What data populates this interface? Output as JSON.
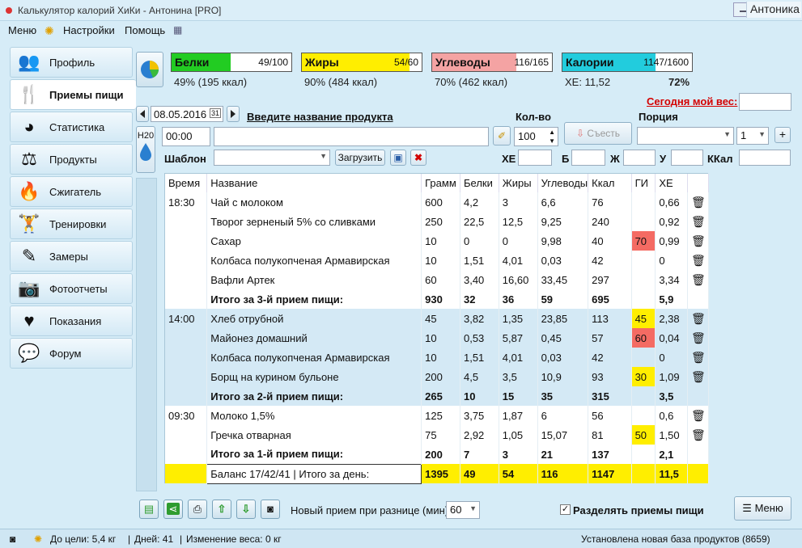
{
  "window": {
    "title": "Калькулятор калорий ХиКи - Антонина [PRO]",
    "user": "Антоника"
  },
  "menu": {
    "m1": "Меню",
    "m2": "Настройки",
    "m3": "Помощь"
  },
  "sidebar": [
    {
      "label": "Профиль",
      "icon": "👥"
    },
    {
      "label": "Приемы пищи",
      "icon": "🍴"
    },
    {
      "label": "Статистика",
      "icon": "◕"
    },
    {
      "label": "Продукты",
      "icon": "⚖"
    },
    {
      "label": "Сжигатель",
      "icon": "🔥"
    },
    {
      "label": "Тренировки",
      "icon": "🏋"
    },
    {
      "label": "Замеры",
      "icon": "✎"
    },
    {
      "label": "Фотоотчеты",
      "icon": "📷"
    },
    {
      "label": "Показания",
      "icon": "♥"
    },
    {
      "label": "Форум",
      "icon": "💬"
    }
  ],
  "nutrients": {
    "protein": {
      "name": "Белки",
      "value": "49/100",
      "sub": "49% (195 ккал)",
      "fraction": 0.49,
      "color": "#22cc22"
    },
    "fat": {
      "name": "Жиры",
      "value": "54/60",
      "sub": "90% (484 ккал)",
      "fraction": 0.9,
      "color": "#ffee00"
    },
    "carbs": {
      "name": "Углеводы",
      "value": "116/165",
      "sub": "70% (462 ккал)",
      "fraction": 0.7,
      "color": "#f4a3a3"
    },
    "calories": {
      "name": "Калории",
      "value": "1147/1600",
      "sub": "ХЕ: 11,52",
      "fraction": 0.72,
      "pct": "72%",
      "color": "#22ccdd"
    }
  },
  "weight_link": "Сегодня мой вес:",
  "entry": {
    "date": "08.05.2016",
    "product_prompt": "Введите название продукта",
    "qty_label": "Кол-во",
    "portion_label": "Порция",
    "time": "00:00",
    "h2o": "H20",
    "qty": "100",
    "eat_button": "Съесть",
    "portion_count": "1",
    "template_label": "Шаблон",
    "load_button": "Загрузить",
    "xe": "ХЕ",
    "b": "Б",
    "zh": "Ж",
    "u": "У",
    "kcal": "ККал"
  },
  "table": {
    "headers": [
      "Время",
      "Название",
      "Грамм",
      "Белки",
      "Жиры",
      "Углеводы",
      "Ккал",
      "ГИ",
      "ХЕ"
    ],
    "rows": [
      {
        "time": "18:30",
        "name": "Чай с молоком",
        "g": "600",
        "b": "4,2",
        "f": "3",
        "c": "6,6",
        "k": "76",
        "gi": "",
        "xe": "0,66",
        "bg": "b1"
      },
      {
        "time": "",
        "name": "Творог зерненый 5% со сливками",
        "g": "250",
        "b": "22,5",
        "f": "12,5",
        "c": "9,25",
        "k": "240",
        "gi": "",
        "xe": "0,92",
        "bg": "b1"
      },
      {
        "time": "",
        "name": "Сахар",
        "g": "10",
        "b": "0",
        "f": "0",
        "c": "9,98",
        "k": "40",
        "gi": "70",
        "gic": "red",
        "xe": "0,99",
        "bg": "b1"
      },
      {
        "time": "",
        "name": "Колбаса полукопченая Армавирская",
        "g": "10",
        "b": "1,51",
        "f": "4,01",
        "c": "0,03",
        "k": "42",
        "gi": "",
        "xe": "0",
        "bg": "b1"
      },
      {
        "time": "",
        "name": "Вафли Артек",
        "g": "60",
        "b": "3,40",
        "f": "16,60",
        "c": "33,45",
        "k": "297",
        "gi": "",
        "xe": "3,34",
        "bg": "b1"
      },
      {
        "time": "",
        "name": "Итого за 3-й прием пищи:",
        "g": "930",
        "b": "32",
        "f": "36",
        "c": "59",
        "k": "695",
        "gi": "",
        "xe": "5,9",
        "bg": "b1",
        "total": true
      },
      {
        "time": "14:00",
        "name": "Хлеб отрубной",
        "g": "45",
        "b": "3,82",
        "f": "1,35",
        "c": "23,85",
        "k": "113",
        "gi": "45",
        "gic": "yel",
        "xe": "2,38",
        "bg": "b2"
      },
      {
        "time": "",
        "name": "Майонез домашний",
        "g": "10",
        "b": "0,53",
        "f": "5,87",
        "c": "0,45",
        "k": "57",
        "gi": "60",
        "gic": "red",
        "xe": "0,04",
        "bg": "b2"
      },
      {
        "time": "",
        "name": "Колбаса полукопченая Армавирская",
        "g": "10",
        "b": "1,51",
        "f": "4,01",
        "c": "0,03",
        "k": "42",
        "gi": "",
        "xe": "0",
        "bg": "b2"
      },
      {
        "time": "",
        "name": "Борщ на курином бульоне",
        "g": "200",
        "b": "4,5",
        "f": "3,5",
        "c": "10,9",
        "k": "93",
        "gi": "30",
        "gic": "yel",
        "xe": "1,09",
        "bg": "b2"
      },
      {
        "time": "",
        "name": "Итого за 2-й прием пищи:",
        "g": "265",
        "b": "10",
        "f": "15",
        "c": "35",
        "k": "315",
        "gi": "",
        "xe": "3,5",
        "bg": "b2",
        "total": true
      },
      {
        "time": "09:30",
        "name": "Молоко 1,5%",
        "g": "125",
        "b": "3,75",
        "f": "1,87",
        "c": "6",
        "k": "56",
        "gi": "",
        "xe": "0,6",
        "bg": "b1"
      },
      {
        "time": "",
        "name": "Гречка отварная",
        "g": "75",
        "b": "2,92",
        "f": "1,05",
        "c": "15,07",
        "k": "81",
        "gi": "50",
        "gic": "yel",
        "xe": "1,50",
        "bg": "b1"
      },
      {
        "time": "",
        "name": "Итого за 1-й прием пищи:",
        "g": "200",
        "b": "7",
        "f": "3",
        "c": "21",
        "k": "137",
        "gi": "",
        "xe": "2,1",
        "bg": "b1",
        "total": true
      }
    ],
    "balance": {
      "name": "Баланс 17/42/41  |  Итого за день:",
      "g": "1395",
      "b": "49",
      "f": "54",
      "c": "116",
      "k": "1147",
      "xe": "11,5"
    }
  },
  "bottom": {
    "interval_label": "Новый прием при разнице (мин)",
    "interval": "60",
    "split_label": "Разделять приемы пищи",
    "menu_button": "Меню"
  },
  "status": {
    "goal": "До цели: 5,4 кг",
    "days": "Дней: 41",
    "change": "Изменение веса: 0 кг",
    "db": "Установлена новая база продуктов (8659)"
  }
}
